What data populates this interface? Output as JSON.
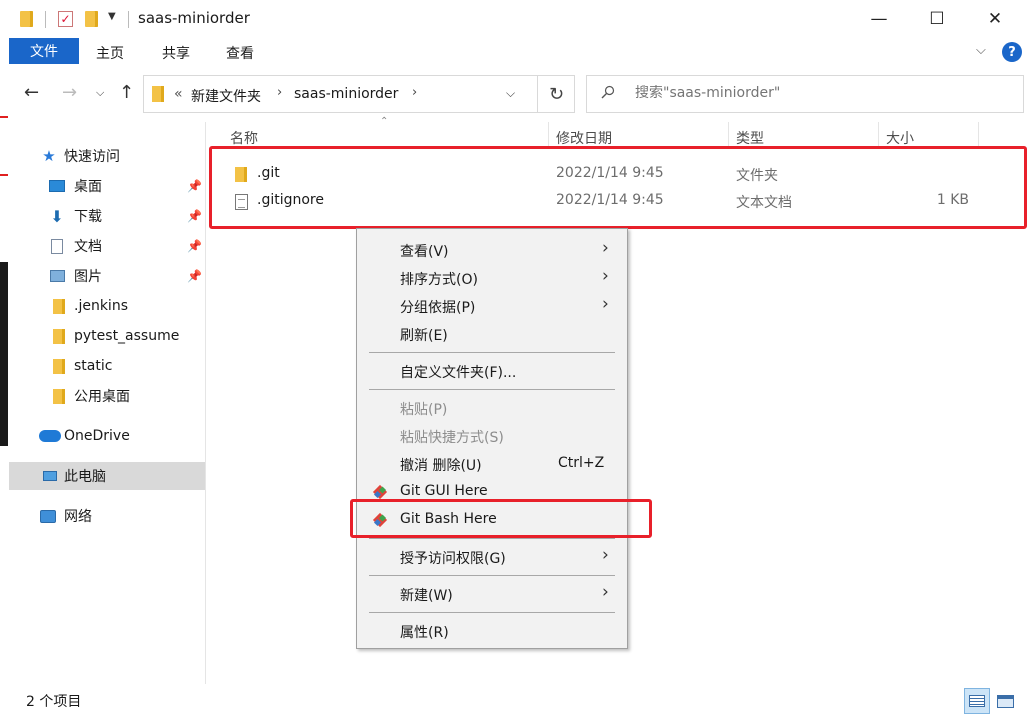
{
  "window": {
    "title": "saas-miniorder",
    "minimize": "—",
    "maximize": "☐",
    "close": "✕"
  },
  "ribbon": {
    "tabs": [
      "文件",
      "主页",
      "共享",
      "查看"
    ],
    "help": "?"
  },
  "address": {
    "prefix": "«",
    "crumbs": [
      "新建文件夹",
      "saas-miniorder"
    ]
  },
  "search": {
    "placeholder": "搜索\"saas-miniorder\""
  },
  "nav": {
    "items": [
      {
        "label": "快速访问",
        "icon": "star-icon"
      },
      {
        "label": "桌面",
        "icon": "desktop-icon",
        "pinned": true
      },
      {
        "label": "下载",
        "icon": "download-icon",
        "pinned": true
      },
      {
        "label": "文档",
        "icon": "document-icon",
        "pinned": true
      },
      {
        "label": "图片",
        "icon": "picture-icon",
        "pinned": true
      },
      {
        "label": ".jenkins",
        "icon": "folder-icon"
      },
      {
        "label": "pytest_assume",
        "icon": "folder-icon"
      },
      {
        "label": "static",
        "icon": "folder-icon"
      },
      {
        "label": "公用桌面",
        "icon": "folder-icon"
      },
      {
        "label": "OneDrive",
        "icon": "onedrive-icon"
      },
      {
        "label": "此电脑",
        "icon": "computer-icon",
        "selected": true
      },
      {
        "label": "网络",
        "icon": "network-icon"
      }
    ]
  },
  "columns": {
    "name": "名称",
    "date": "修改日期",
    "type": "类型",
    "size": "大小"
  },
  "files": [
    {
      "name": ".git",
      "date": "2022/1/14 9:45",
      "type": "文件夹",
      "size": "",
      "icon": "folder-icon"
    },
    {
      "name": ".gitignore",
      "date": "2022/1/14 9:45",
      "type": "文本文档",
      "size": "1 KB",
      "icon": "text-file-icon"
    }
  ],
  "context_menu": {
    "items": [
      {
        "label": "查看(V)",
        "submenu": true
      },
      {
        "label": "排序方式(O)",
        "submenu": true
      },
      {
        "label": "分组依据(P)",
        "submenu": true
      },
      {
        "label": "刷新(E)"
      },
      {
        "label": "自定义文件夹(F)..."
      },
      {
        "label": "粘贴(P)",
        "disabled": true
      },
      {
        "label": "粘贴快捷方式(S)",
        "disabled": true
      },
      {
        "label": "撤消 删除(U)",
        "shortcut": "Ctrl+Z"
      },
      {
        "label": "Git GUI Here",
        "icon": "git-icon"
      },
      {
        "label": "Git Bash Here",
        "icon": "git-icon"
      },
      {
        "label": "授予访问权限(G)",
        "submenu": true
      },
      {
        "label": "新建(W)",
        "submenu": true
      },
      {
        "label": "属性(R)"
      }
    ]
  },
  "status": {
    "count": "2 个项目"
  },
  "colors": {
    "accent": "#1a66c9",
    "highlight_box": "#e8202a",
    "folder": "#f3c246"
  }
}
